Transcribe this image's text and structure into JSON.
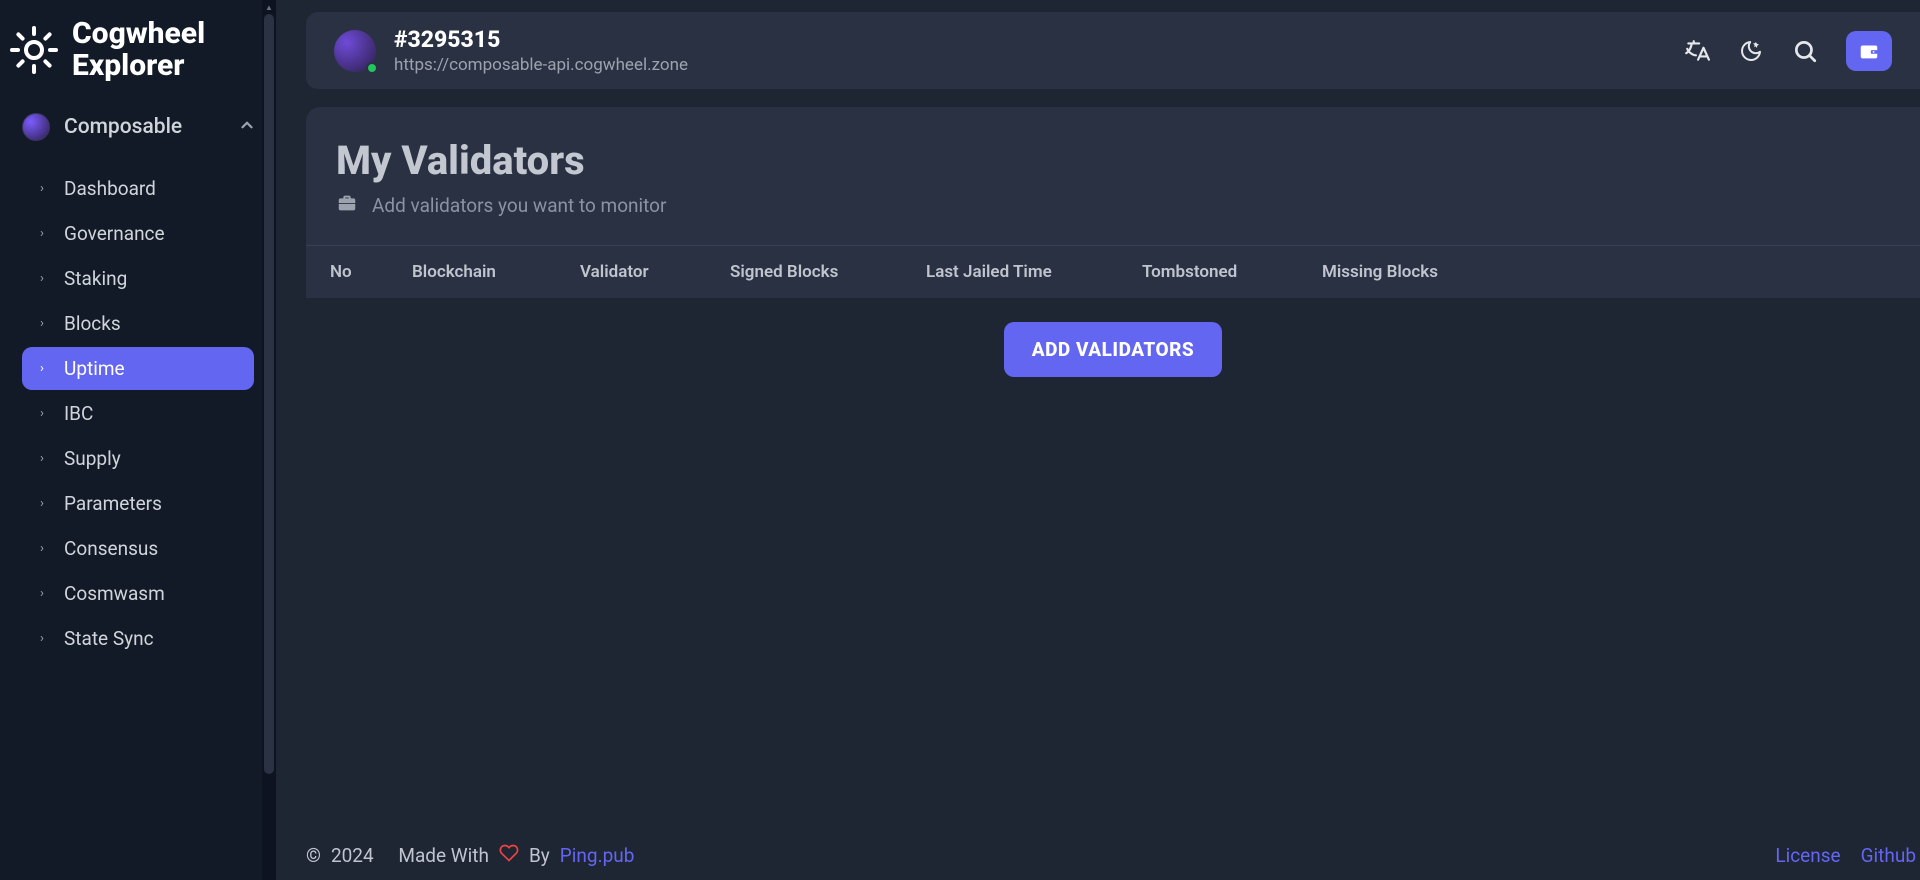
{
  "brand": {
    "line1": "Cogwheel",
    "line2": "Explorer"
  },
  "chain": {
    "name": "Composable"
  },
  "nav": {
    "items": [
      {
        "label": "Dashboard",
        "active": false
      },
      {
        "label": "Governance",
        "active": false
      },
      {
        "label": "Staking",
        "active": false
      },
      {
        "label": "Blocks",
        "active": false
      },
      {
        "label": "Uptime",
        "active": true
      },
      {
        "label": "IBC",
        "active": false
      },
      {
        "label": "Supply",
        "active": false
      },
      {
        "label": "Parameters",
        "active": false
      },
      {
        "label": "Consensus",
        "active": false
      },
      {
        "label": "Cosmwasm",
        "active": false
      },
      {
        "label": "State Sync",
        "active": false
      }
    ]
  },
  "topbar": {
    "block_height": "#3295315",
    "api_url": "https://composable-api.cogwheel.zone"
  },
  "page": {
    "title": "My Validators",
    "subtitle": "Add validators you want to monitor",
    "columns": {
      "no": "No",
      "blockchain": "Blockchain",
      "validator": "Validator",
      "signed_blocks": "Signed Blocks",
      "last_jailed": "Last Jailed Time",
      "tombstoned": "Tombstoned",
      "missing_blocks": "Missing Blocks"
    },
    "add_button": "ADD VALIDATORS"
  },
  "footer": {
    "copyright": "©",
    "year": "2024",
    "made_with": "Made With",
    "by": "By",
    "author": "Ping.pub",
    "license": "License",
    "github": "Github"
  }
}
